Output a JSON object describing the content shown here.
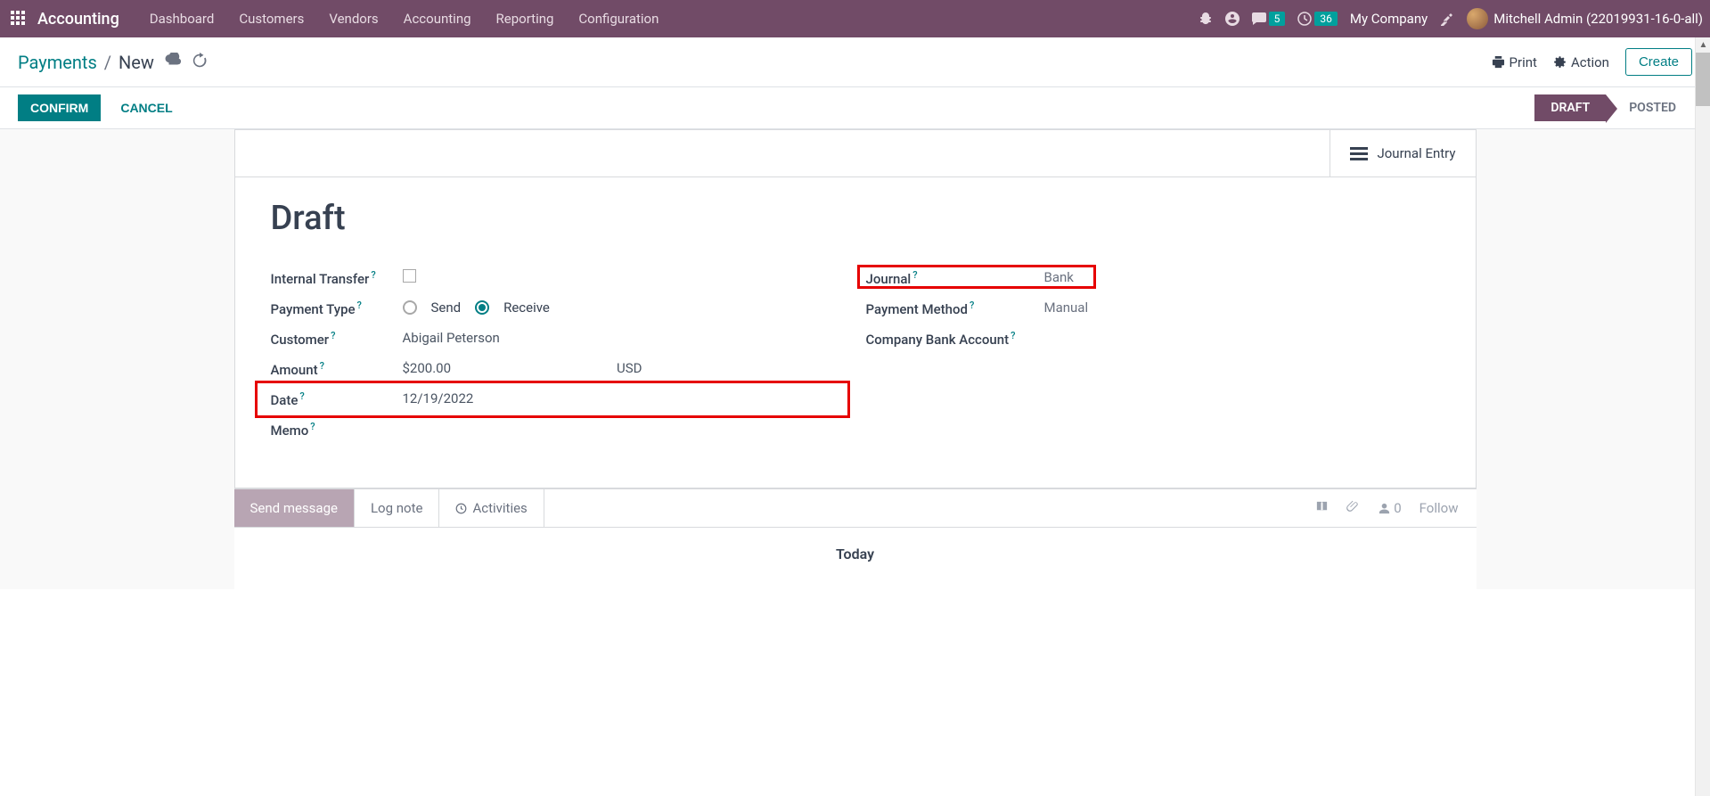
{
  "navbar": {
    "brand": "Accounting",
    "menu": [
      "Dashboard",
      "Customers",
      "Vendors",
      "Accounting",
      "Reporting",
      "Configuration"
    ],
    "messages_badge": "5",
    "activities_badge": "36",
    "company": "My Company",
    "user": "Mitchell Admin (22019931-16-0-all)"
  },
  "breadcrumb": {
    "root": "Payments",
    "current": "New",
    "print": "Print",
    "action": "Action",
    "create": "Create"
  },
  "statusbar": {
    "confirm": "Confirm",
    "cancel": "Cancel",
    "draft": "Draft",
    "posted": "Posted"
  },
  "sheet": {
    "journal_entry": "Journal Entry",
    "title": "Draft",
    "labels": {
      "internal_transfer": "Internal Transfer",
      "payment_type": "Payment Type",
      "customer": "Customer",
      "amount": "Amount",
      "date": "Date",
      "memo": "Memo",
      "journal": "Journal",
      "payment_method": "Payment Method",
      "company_bank": "Company Bank Account"
    },
    "values": {
      "payment_type_send": "Send",
      "payment_type_receive": "Receive",
      "customer": "Abigail Peterson",
      "amount": "$200.00",
      "currency": "USD",
      "date": "12/19/2022",
      "journal": "Bank",
      "payment_method": "Manual"
    }
  },
  "chatter": {
    "send_message": "Send message",
    "log_note": "Log note",
    "activities": "Activities",
    "followers": "0",
    "follow": "Follow",
    "today": "Today"
  }
}
